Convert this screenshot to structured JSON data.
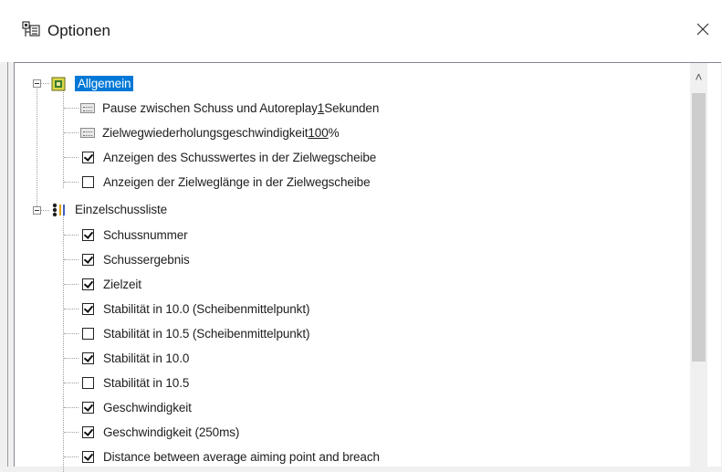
{
  "window": {
    "title": "Optionen",
    "close_symbol": "✕"
  },
  "tree": {
    "groups": [
      {
        "label": "Allgemein",
        "icon": "settings-group-icon",
        "expanded": true,
        "selected": true,
        "items": [
          {
            "type": "number",
            "prefix": "Pause zwischen Schuss und Autoreplay ",
            "value": "1",
            "suffix": " Sekunden"
          },
          {
            "type": "number",
            "prefix": "Zielwegwiederholungsgeschwindigkeit ",
            "value": "100",
            "suffix": " %"
          },
          {
            "type": "checkbox",
            "label": "Anzeigen des Schusswertes in der Zielwegscheibe",
            "checked": true
          },
          {
            "type": "checkbox",
            "label": "Anzeigen der Zielweglänge in der Zielwegscheibe",
            "checked": false
          }
        ]
      },
      {
        "label": "Einzelschussliste",
        "icon": "list-group-icon",
        "expanded": true,
        "selected": false,
        "items": [
          {
            "type": "checkbox",
            "label": "Schussnummer",
            "checked": true
          },
          {
            "type": "checkbox",
            "label": "Schussergebnis",
            "checked": true
          },
          {
            "type": "checkbox",
            "label": "Zielzeit",
            "checked": true
          },
          {
            "type": "checkbox",
            "label": "Stabilität in 10.0 (Scheibenmittelpunkt)",
            "checked": true
          },
          {
            "type": "checkbox",
            "label": "Stabilität in 10.5 (Scheibenmittelpunkt)",
            "checked": false
          },
          {
            "type": "checkbox",
            "label": "Stabilität in 10.0",
            "checked": true
          },
          {
            "type": "checkbox",
            "label": "Stabilität in 10.5",
            "checked": false
          },
          {
            "type": "checkbox",
            "label": "Geschwindigkeit",
            "checked": true
          },
          {
            "type": "checkbox",
            "label": "Geschwindigkeit (250ms)",
            "checked": true
          },
          {
            "type": "checkbox",
            "label": "Distance between average aiming point and breach",
            "checked": true
          }
        ]
      }
    ]
  },
  "scrollbar": {
    "up_arrow": "˄"
  }
}
